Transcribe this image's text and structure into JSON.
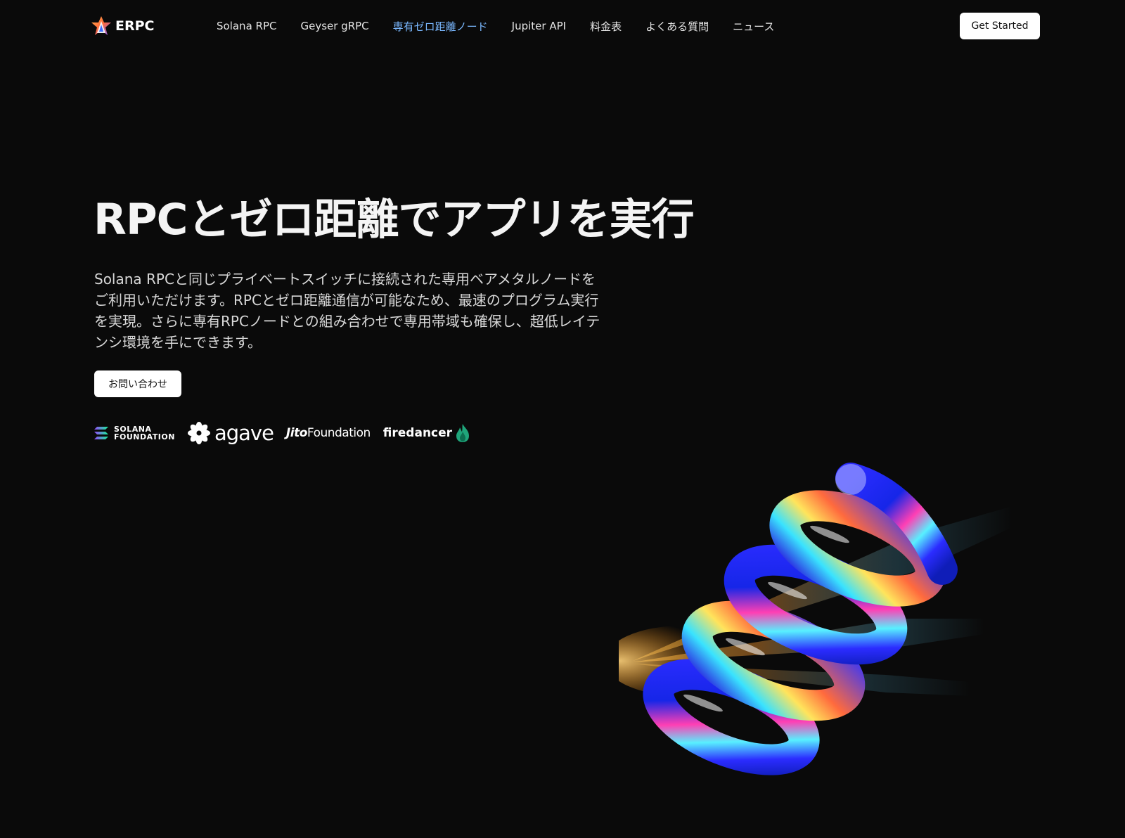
{
  "header": {
    "logo_text": "ERPC",
    "nav": [
      {
        "label": "Solana RPC",
        "active": false
      },
      {
        "label": "Geyser gRPC",
        "active": false
      },
      {
        "label": "専有ゼロ距離ノード",
        "active": true
      },
      {
        "label": "Jupiter API",
        "active": false
      },
      {
        "label": "料金表",
        "active": false
      },
      {
        "label": "よくある質問",
        "active": false
      },
      {
        "label": "ニュース",
        "active": false
      }
    ],
    "cta_label": "Get Started"
  },
  "hero": {
    "title": "RPCとゼロ距離でアプリを実行",
    "description": "Solana RPCと同じプライベートスイッチに接続された専用ベアメタルノードをご利用いただけます。RPCとゼロ距離通信が可能なため、最速のプログラム実行を実現。さらに専有RPCノードとの組み合わせで専用帯域も確保し、超低レイテンシ環境を手にできます。",
    "contact_label": "お問い合わせ"
  },
  "partners": {
    "solana_line1": "SOLANA",
    "solana_line2": "FOUNDATION",
    "agave": "agave",
    "jito": "Jito",
    "jito_suffix": "Foundation",
    "firedancer": "firedancer"
  },
  "colors": {
    "background": "#0a0a0a",
    "active_nav": "#7ab8ff",
    "button_bg": "#ffffff"
  }
}
